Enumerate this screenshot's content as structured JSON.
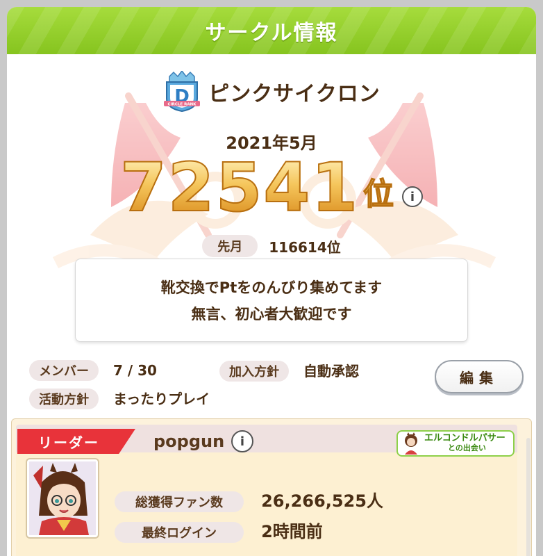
{
  "header": {
    "title": "サークル情報"
  },
  "circle": {
    "name": "ピンクサイクロン",
    "rank_badge_letter": "D",
    "rank_badge_caption": "CIRCLE RANK",
    "month": "2021年5月",
    "rank": "72541",
    "rank_unit": "位",
    "info_icon": "i",
    "last_month_label": "先月",
    "last_month_value": "116614位",
    "description_lines": [
      "靴交換でPtをのんびり集めてます",
      "無言、初心者大歓迎です"
    ],
    "members_label": "メンバー",
    "members_value": "7 / 30",
    "join_policy_label": "加入方針",
    "join_policy_value": "自動承認",
    "activity_label": "活動方針",
    "activity_value": "まったりプレイ",
    "edit_button": "編集"
  },
  "leader": {
    "tag": "リーダー",
    "name": "popgun",
    "info_icon": "i",
    "encounter_line1": "エルコンドルパサー",
    "encounter_line2": "との出会い",
    "fans_label": "総獲得ファン数",
    "fans_value": "26,266,525人",
    "last_login_label": "最終ログイン",
    "last_login_value": "2時間前"
  },
  "colors": {
    "header_green": "#8ec82a",
    "leader_red": "#e8333a",
    "rank_gold": "#e7a43b",
    "text_brown": "#4a2e14"
  }
}
